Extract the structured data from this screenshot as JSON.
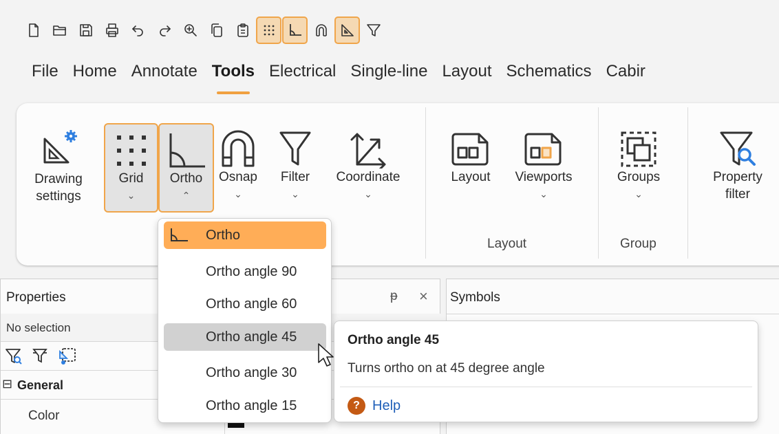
{
  "quick_access": {
    "icons": [
      "new-file-icon",
      "open-folder-icon",
      "save-icon",
      "print-icon",
      "undo-icon",
      "redo-icon",
      "zoom-icon",
      "copy-icon",
      "paste-icon",
      "grid-icon",
      "ortho-icon",
      "osnap-icon",
      "drawing-settings-icon",
      "filter-icon"
    ],
    "toggled_on": [
      "grid-icon",
      "ortho-icon",
      "drawing-settings-icon"
    ]
  },
  "menubar": {
    "items": [
      "File",
      "Home",
      "Annotate",
      "Tools",
      "Electrical",
      "Single-line",
      "Layout",
      "Schematics",
      "Cabir"
    ],
    "active": "Tools"
  },
  "ribbon": {
    "drawing_settings": {
      "line1": "Drawing",
      "line2": "settings"
    },
    "grid": {
      "label": "Grid",
      "chevron": "⌄"
    },
    "ortho": {
      "label": "Ortho",
      "chevron": "⌃"
    },
    "osnap": {
      "label": "Osnap",
      "chevron": "⌄"
    },
    "filter": {
      "label": "Filter",
      "chevron": "⌄"
    },
    "coordinate": {
      "label": "Coordinate",
      "chevron": "⌄"
    },
    "layout": {
      "label": "Layout"
    },
    "viewports": {
      "label": "Viewports",
      "chevron": "⌄"
    },
    "groups": {
      "label": "Groups",
      "chevron": "⌄"
    },
    "property_filter": {
      "line1": "Property",
      "line2": "filter"
    },
    "group_labels": {
      "layout": "Layout",
      "group": "Group"
    }
  },
  "properties_panel": {
    "title": "Properties",
    "pin_icon": "ᵽ",
    "close_icon": "×",
    "selection": "No selection",
    "section": "General",
    "collapse_symbol": "⊟",
    "color_label": "Color"
  },
  "symbols_panel": {
    "title": "Symbols"
  },
  "ortho_dropdown": {
    "items": [
      "Ortho",
      "Ortho angle 90",
      "Ortho angle 60",
      "Ortho angle 45",
      "Ortho angle 30",
      "Ortho angle 15"
    ],
    "checked": "Ortho",
    "hovered": "Ortho angle 45"
  },
  "tooltip": {
    "title": "Ortho angle 45",
    "description": "Turns ortho on at 45 degree angle",
    "help_label": "Help",
    "help_symbol": "?"
  },
  "colors": {
    "accent": "#f0a54a",
    "checked_item": "#ffad57",
    "hover_item": "#d1d1d1",
    "blue_icon": "#2f7fe0",
    "help_icon": "#c45a14"
  }
}
